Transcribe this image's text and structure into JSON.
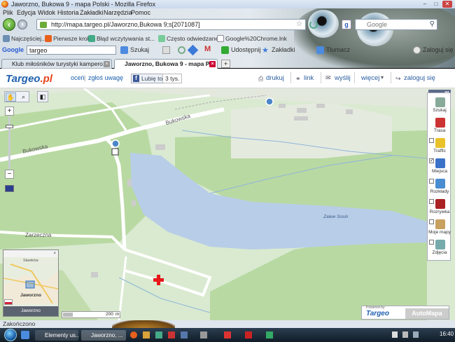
{
  "window": {
    "title": "Jaworzno, Bukowa 9 - mapa Polski - Mozilla Firefox",
    "controls": [
      "minimize",
      "maximize",
      "close"
    ]
  },
  "menu": [
    "Plik",
    "Edycja",
    "Widok",
    "Historia",
    "Zakładki",
    "Narzędzia",
    "Pomoc"
  ],
  "nav": {
    "url": "http://mapa.targeo.pl/Jaworzno,Bukowa 9;s[2071087]",
    "search_placeholder": "Google"
  },
  "bookmarks": [
    "Najczęściej...",
    "Pierwsze kroki",
    "Błąd wczytywania st...",
    "Często odwiedzane",
    "Google%20Chrome.lnk"
  ],
  "google_toolbar": {
    "label": "Google",
    "search_value": "targeo",
    "items": [
      "Szukaj",
      "Udostępnij",
      "Zakładki",
      "Tłumacz",
      "Zaloguj się"
    ]
  },
  "tabs": [
    {
      "label": "Klub miłośników turystyki kampero...",
      "active": false
    },
    {
      "label": "Jaworzno, Bukowa 9 - mapa P...",
      "active": true
    }
  ],
  "page_header": {
    "logo_text": "Targeo",
    "logo_suffix": ".pl",
    "links": [
      "oceń",
      "zgłoś uwagę"
    ],
    "fb_like": "Lubię to!",
    "fb_count": "3 tys.",
    "actions": [
      "drukuj",
      "link",
      "wyślij",
      "więcej",
      "zaloguj się"
    ]
  },
  "map": {
    "labels": {
      "street_1": "Bukowska",
      "street_2": "Bukowska",
      "place_1": "Zarzeczna",
      "lake": "Zalew Sosin",
      "minimap_city": "Jaworzno",
      "minimap_label": "Jaworzno",
      "minimap_top": "Sławków",
      "scale": "200",
      "scale_unit": "m"
    },
    "tools": [
      {
        "label": "Szukaj",
        "checked": null
      },
      {
        "label": "Trasa",
        "checked": null
      },
      {
        "label": "Traffic",
        "checked": false
      },
      {
        "label": "Miejsca",
        "checked": true
      },
      {
        "label": "Rozkłady",
        "checked": false
      },
      {
        "label": "Rozrywka",
        "checked": false
      },
      {
        "label": "Moje mapy",
        "checked": false
      },
      {
        "label": "Zdjęcia",
        "checked": false
      }
    ],
    "powered_by": "Powered by:",
    "powered_targeo": "Targeo",
    "powered_automapa": "AutoMapa",
    "colors": {
      "land": "#d9ead0",
      "green": "#b9d9a3",
      "water": "#b8cde7",
      "road": "#ffffff",
      "marker": "#e8171a"
    }
  },
  "statusbar": "Zakończono",
  "taskbar": {
    "tasks": [
      "Elementy us...",
      "Jaworzno, ..."
    ],
    "clock": "16:40"
  }
}
